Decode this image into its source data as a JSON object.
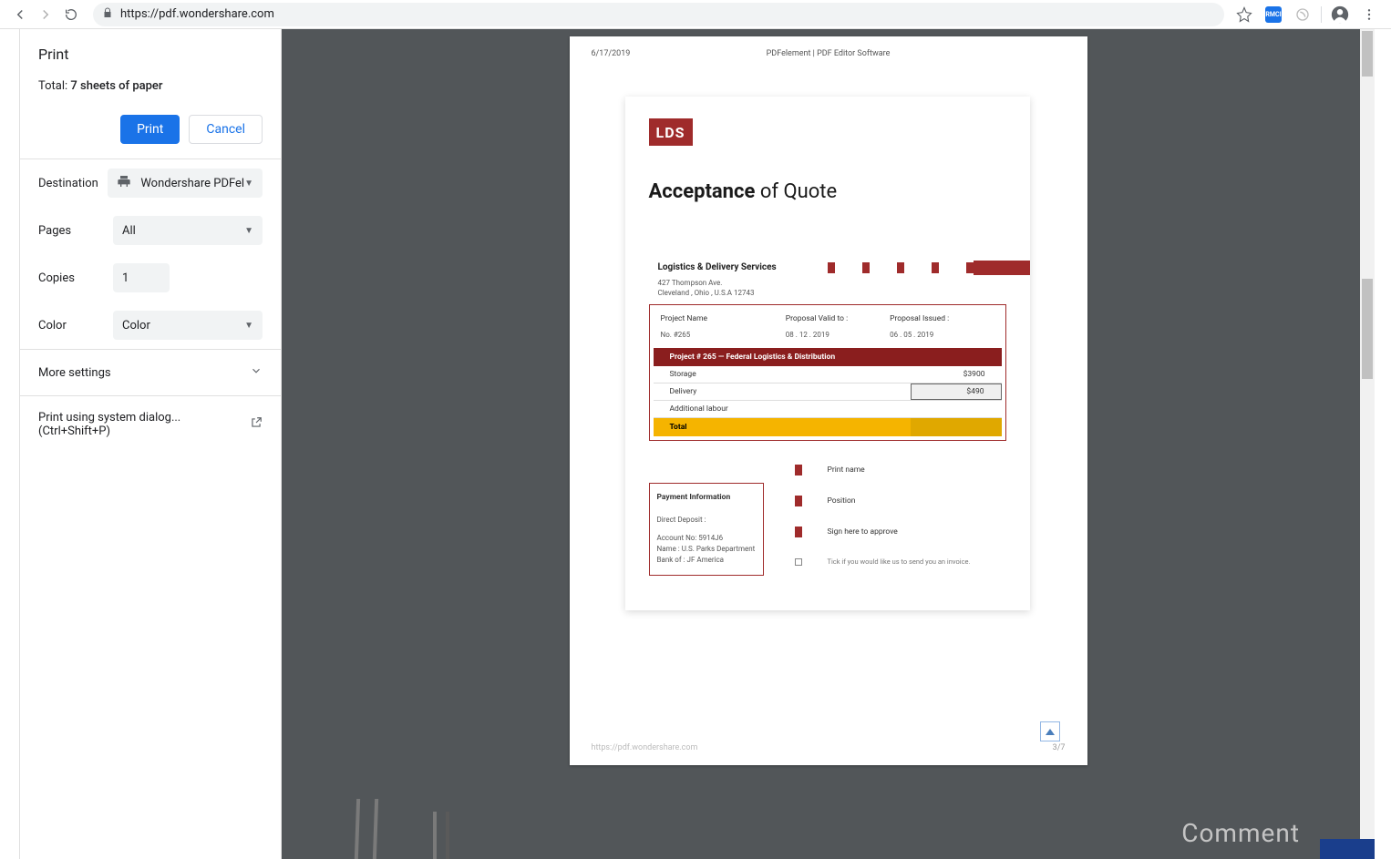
{
  "browser": {
    "url": "https://pdf.wondershare.com",
    "ext_badge": "RMCI"
  },
  "print_panel": {
    "title": "Print",
    "total_prefix": "Total: ",
    "total_value": "7 sheets of paper",
    "print_btn": "Print",
    "cancel_btn": "Cancel",
    "destination_label": "Destination",
    "destination_value": "Wondershare PDFel",
    "pages_label": "Pages",
    "pages_value": "All",
    "copies_label": "Copies",
    "copies_value": "1",
    "color_label": "Color",
    "color_value": "Color",
    "more_settings": "More settings",
    "system_dialog": "Print using system dialog... (Ctrl+Shift+P)"
  },
  "page_meta": {
    "date": "6/17/2019",
    "center": "PDFelement | PDF Editor Software",
    "footer_url": "https://pdf.wondershare.com",
    "footer_page": "3/7"
  },
  "document": {
    "logo_text": "LDS",
    "title_bold": "Acceptance",
    "title_rest": " of Quote",
    "supplier_name": "Logistics & Delivery Services",
    "supplier_addr1": "427 Thompson Ave.",
    "supplier_addr2": "Cleveland , Ohio , U.S.A 12743",
    "info": {
      "h1": "Project Name",
      "h2": "Proposal Valid to :",
      "h3": "Proposal Issued :",
      "v1": "No. #265",
      "v2": "08 . 12 . 2019",
      "v3": "06 . 05 . 2019"
    },
    "project_header": "Project # 265 — Federal Logistics & Distribution",
    "lines": {
      "storage": "Storage",
      "storage_amt": "$3900",
      "delivery": "Delivery",
      "delivery_amt": "$490",
      "labour": "Additional labour",
      "total": "Total"
    },
    "payment": {
      "title": "Payment Information",
      "dd": "Direct Deposit :",
      "acct": "Account No: 5914J6",
      "name": "Name : U.S. Parks Department",
      "bank": "Bank of : JF America"
    },
    "sig": {
      "print_name": "Print name",
      "position": "Position",
      "sign": "Sign here to approve",
      "tick": "Tick if you would like us to send you an invoice."
    }
  },
  "bottom": {
    "comment": "Comment"
  }
}
